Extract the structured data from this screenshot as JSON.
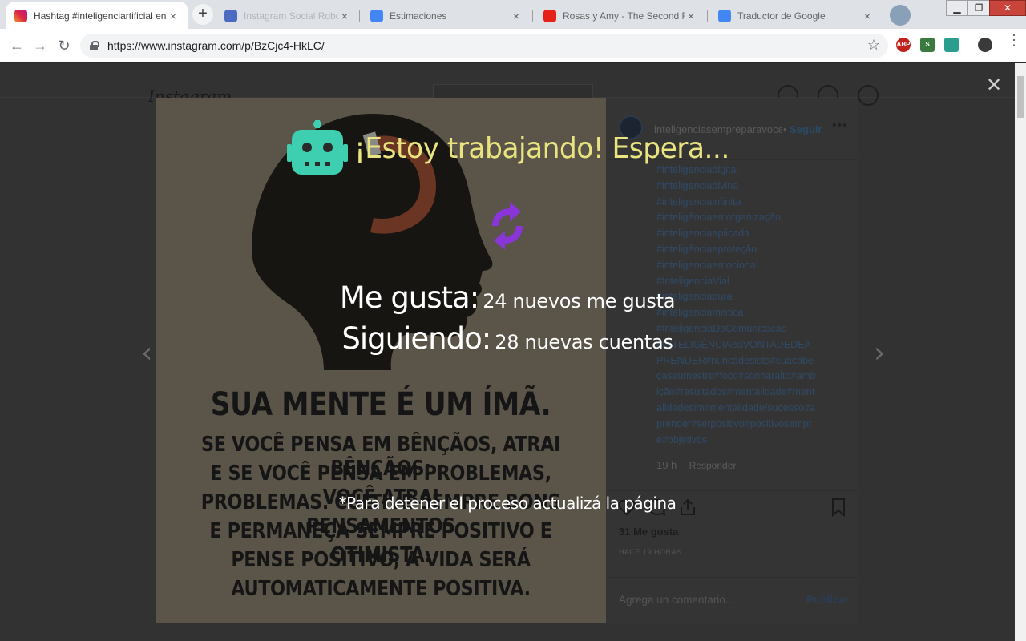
{
  "browser": {
    "active_tab": {
      "title": "Hashtag #inteligenciartificial en",
      "close": "×"
    },
    "background_tabs": [
      {
        "title": "Instagram Social Robot - Editar"
      },
      {
        "title": "Estimaciones"
      },
      {
        "title": "Rosas y Amy - The Second Ro"
      },
      {
        "title": "Traductor de Google"
      }
    ],
    "new_tab": "+",
    "window_controls": {
      "minimize": "▁",
      "maximize": "❐",
      "close": "✕"
    },
    "nav": {
      "back": "←",
      "forward": "→",
      "reload": "↻"
    },
    "url": "https://www.instagram.com/p/BzCjc4-HkLC/",
    "bookmark": "☆",
    "extensions": [
      {
        "label": "ABP",
        "color": "#c0231e"
      },
      {
        "label": "S",
        "color": "#3b7b3f"
      },
      {
        "label": "",
        "color": "#2a9d8f"
      }
    ],
    "menu": "⋮"
  },
  "instagram": {
    "logo": "Instagram",
    "close_modal": "✕",
    "prev_arrow": "‹",
    "next_arrow": "›",
    "image_text": {
      "title": "SUA MENTE É UM ÍMÃ.",
      "lines": [
        "SE VOCÊ PENSA EM BÊNÇÃOS, ATRAI BÊNÇÃOS;",
        "E SE VOCÊ PENSA EM PROBLEMAS, VOCÊ ATRAI",
        "PROBLEMAS. CULTIVE SEMPRE BONS PENSAMENTOS",
        "E PERMANEÇA SEMPRE POSITIVO E OTIMISTA.",
        "PENSE POSITIVO, A VIDA SERÁ",
        "AUTOMATICAMENTE POSITIVA."
      ]
    },
    "post": {
      "username": "inteligenciasempreparavoce",
      "separator": "•",
      "follow": "Seguir",
      "more": "•••",
      "hashtags": [
        "#inteligenciadigital",
        "#inteligenciadivina",
        "#inteligenciainfinita",
        "#inteligênciaemorganização",
        "#inteligenciaaplicada",
        "#inteligênciaeproteção",
        "#inteligenciaemocional",
        "#InteligenciaVial",
        "#inteligenciapura",
        "#inteligenciamistica",
        "#InteligenciaDaComunicacao"
      ],
      "runon_caption": "#INTELIGÊNCIAeaVONTADEDEAPRENDER#nuncadesista#suacabeçaseumestre#foco#sonharalto#ambição#resultados#mentalidade#mentalidadesim#mentalidade/sucesso#aprender#serpositivo#positivosempre#objetivos",
      "comment_time": "19 h",
      "reply": "Responder",
      "likes": "31 Me gusta",
      "time_ago": "HACE 19 HORAS",
      "comment_placeholder": "Agrega un comentario...",
      "publish": "Publicar"
    }
  },
  "overlay": {
    "title": "¡Estoy trabajando! Espera...",
    "likes_label": "Me gusta:",
    "likes_value": "24 nuevos me gusta",
    "following_label": "Siguiendo:",
    "following_value": "28 nuevas cuentas",
    "note": "*Para detener el proceso actualizá la página",
    "colors": {
      "title": "#e9e480",
      "robot": "#3ecfb0",
      "sync": "#8a35d8",
      "text": "#ffffff"
    }
  }
}
